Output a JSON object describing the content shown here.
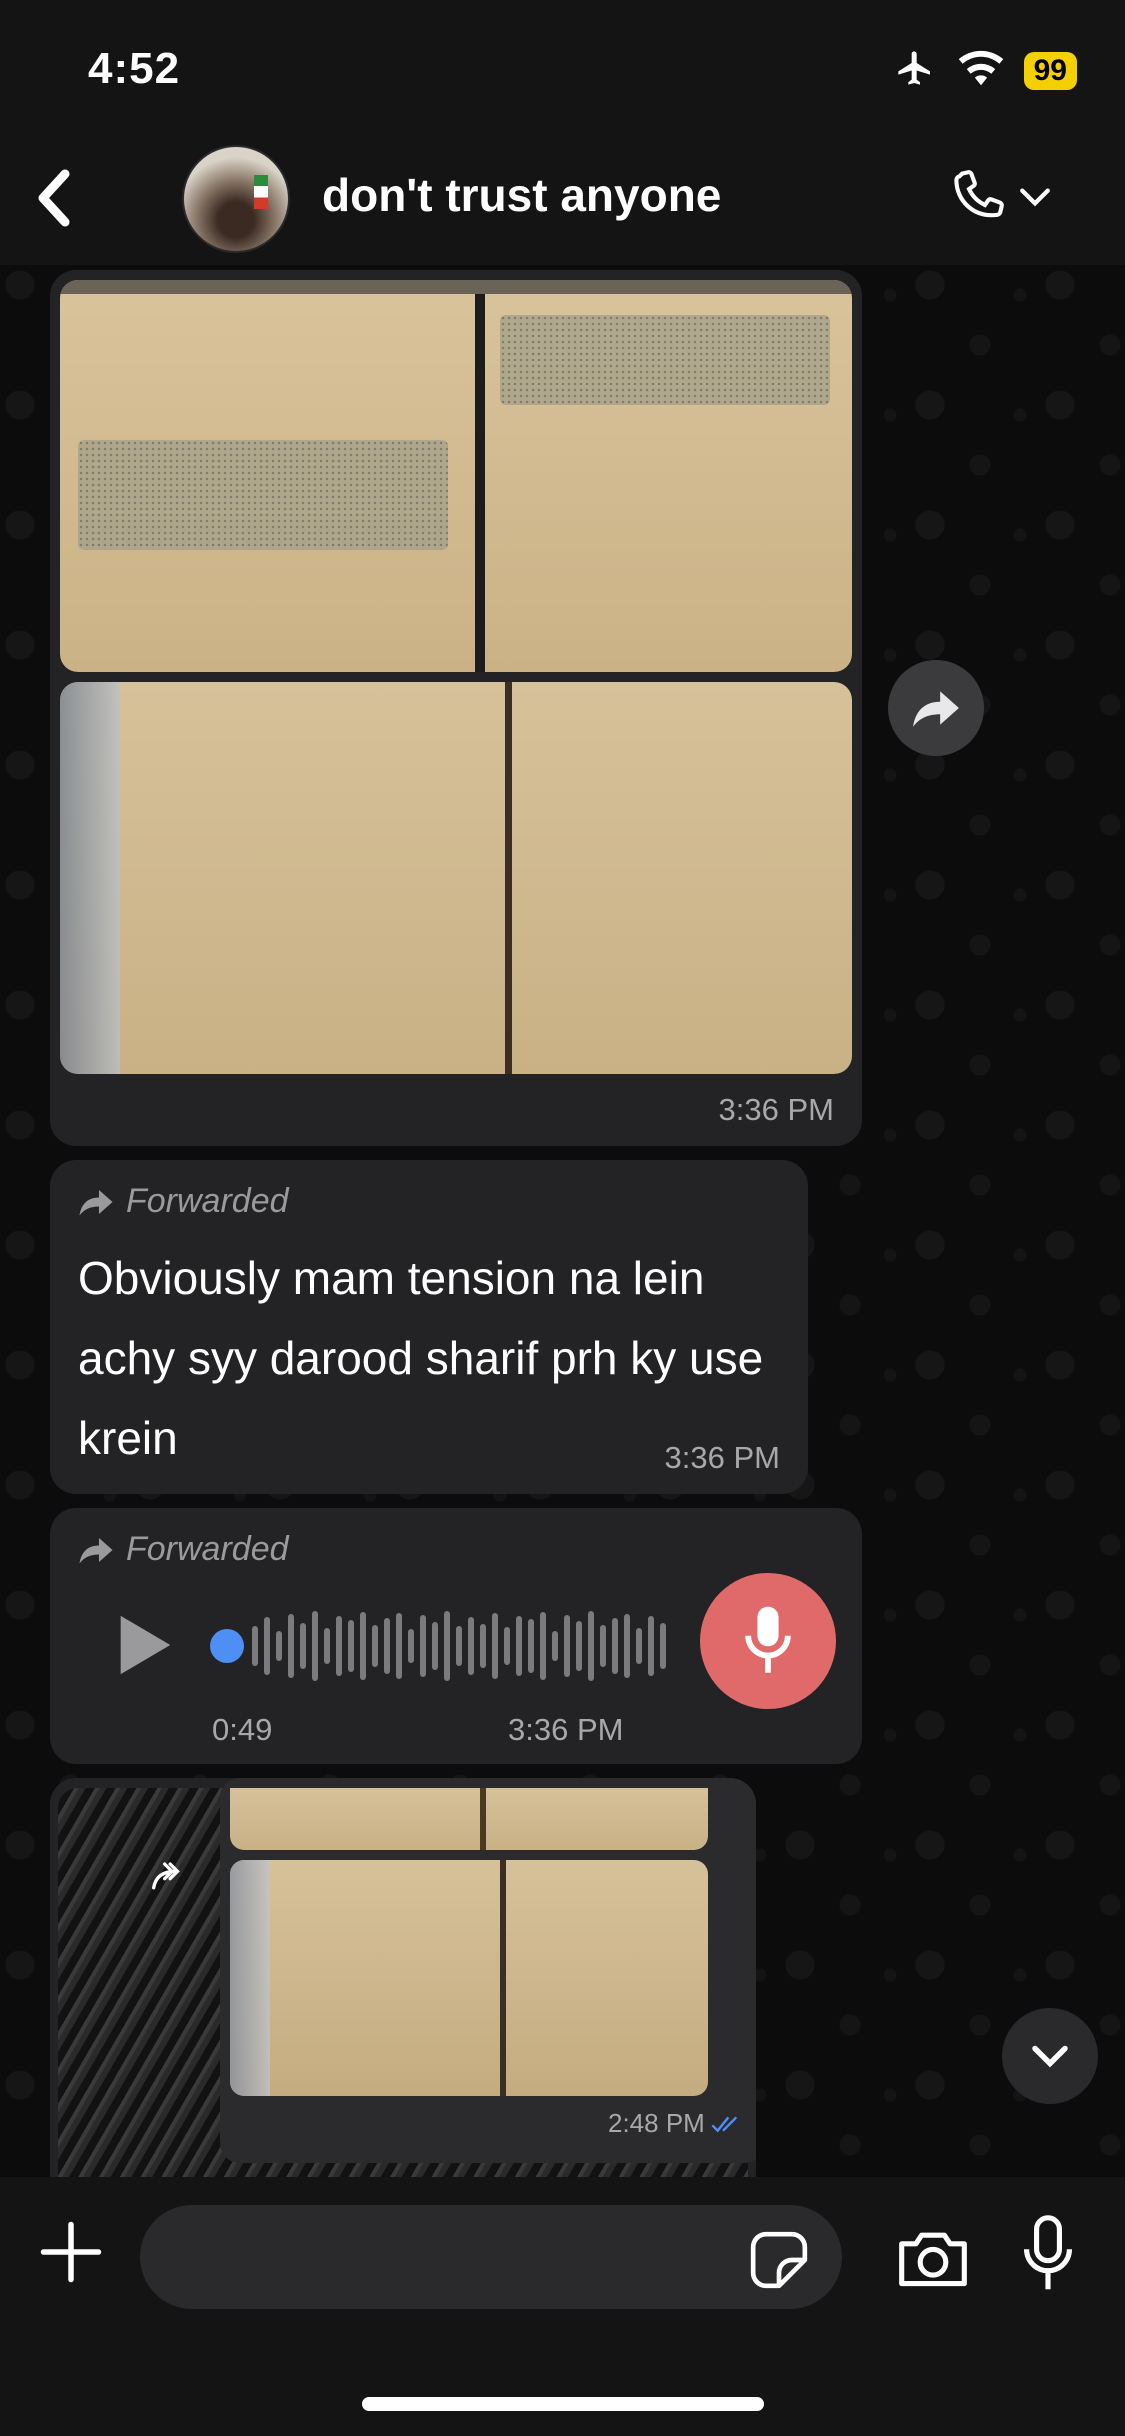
{
  "status_bar": {
    "time": "4:52",
    "battery": "99",
    "icons": [
      "airplane-icon",
      "wifi-icon",
      "battery-icon"
    ]
  },
  "header": {
    "title": "don't trust anyone",
    "icons": [
      "back-icon",
      "avatar",
      "phone-icon",
      "chevron-down-icon"
    ]
  },
  "messages": {
    "photo_album": {
      "time": "3:36 PM"
    },
    "text_message": {
      "forwarded_label": "Forwarded",
      "text": "Obviously mam tension na lein achy syy darood sharif prh ky use krein",
      "time": "3:36 PM"
    },
    "voice_message": {
      "forwarded_label": "Forwarded",
      "duration": "0:49",
      "time": "3:36 PM",
      "progress": 0
    },
    "nested_forward": {
      "time": "2:48 PM"
    }
  },
  "input": {
    "placeholder": "",
    "value": ""
  },
  "colors": {
    "background": "#0b0b0c",
    "bubble": "#232325",
    "accent_blue": "#4d8ff5",
    "mic_avatar": "#e06a6a",
    "battery": "#f5d000"
  }
}
